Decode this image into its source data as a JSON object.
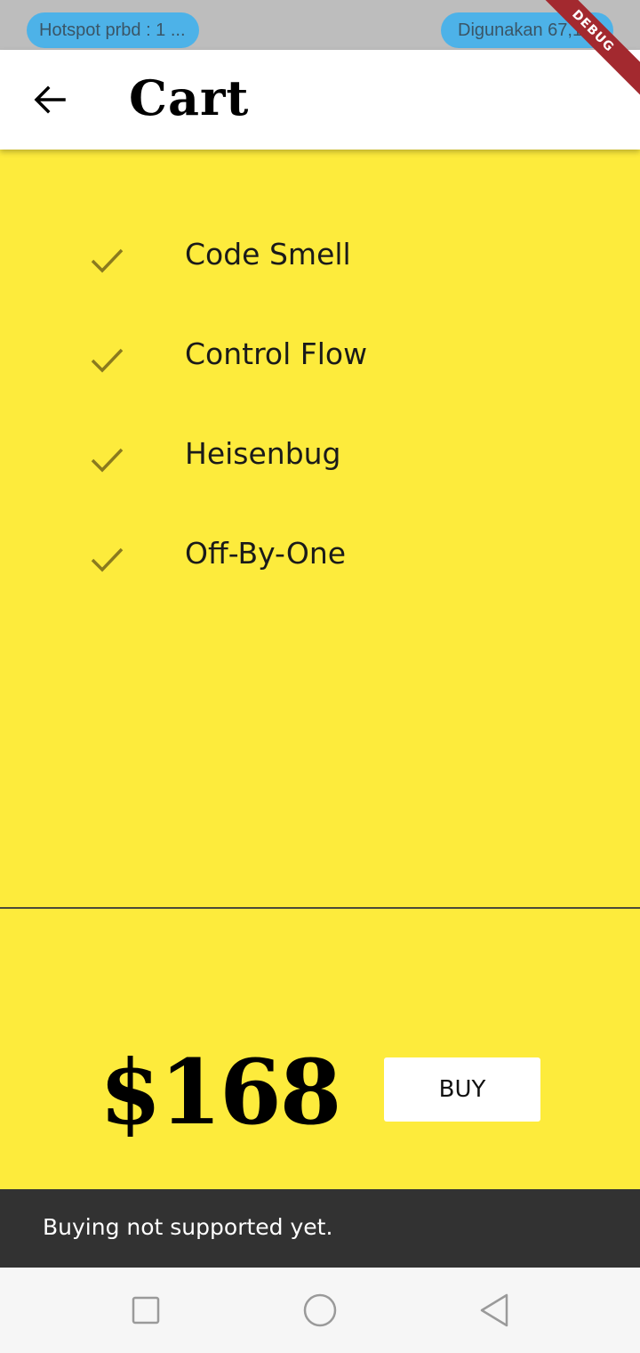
{
  "status_bar": {
    "left_pill": "Hotspot prbd : 1 ...",
    "right_pill": "Digunakan 67,1"
  },
  "debug_banner": "DEBUG",
  "app_bar": {
    "title": "Cart",
    "back_icon": "arrow-left-icon"
  },
  "cart": {
    "items": [
      {
        "label": "Code Smell",
        "icon": "check-icon"
      },
      {
        "label": "Control Flow",
        "icon": "check-icon"
      },
      {
        "label": "Heisenbug",
        "icon": "check-icon"
      },
      {
        "label": "Off-By-One",
        "icon": "check-icon"
      }
    ]
  },
  "total": {
    "amount": "$168",
    "buy_label": "BUY"
  },
  "snackbar": {
    "message": "Buying not supported yet."
  },
  "nav_bar": {
    "icons": [
      "recents-square-icon",
      "home-circle-icon",
      "back-triangle-icon"
    ]
  },
  "colors": {
    "background": "#fdeb3c",
    "check": "#8a7a1e",
    "snackbar": "#323232",
    "status_pill": "#4db2e8",
    "debug_banner": "#a3292f"
  }
}
